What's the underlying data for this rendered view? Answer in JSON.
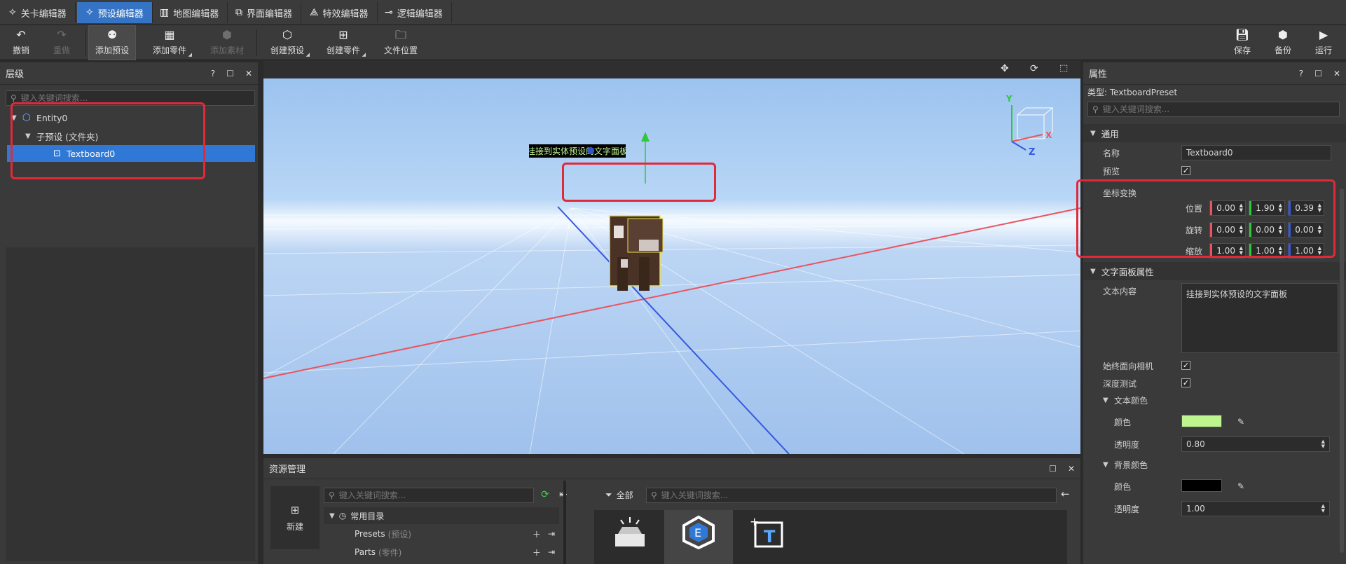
{
  "tabs": [
    {
      "label": "关卡编辑器",
      "icon": "level-icon",
      "active": false
    },
    {
      "label": "预设编辑器",
      "icon": "preset-icon",
      "active": true
    },
    {
      "label": "地图编辑器",
      "icon": "map-icon",
      "active": false
    },
    {
      "label": "界面编辑器",
      "icon": "ui-icon",
      "active": false
    },
    {
      "label": "特效编辑器",
      "icon": "effects-icon",
      "active": false
    },
    {
      "label": "逻辑编辑器",
      "icon": "logic-icon",
      "active": false
    }
  ],
  "toolbar": {
    "undo": "撤销",
    "redo": "重做",
    "add_preset": "添加预设",
    "add_part": "添加零件",
    "add_material": "添加素材",
    "create_preset": "创建预设",
    "create_part": "创建零件",
    "file_location": "文件位置",
    "save": "保存",
    "backup": "备份",
    "run": "运行"
  },
  "hierarchy": {
    "title": "层级",
    "help": "?",
    "search_placeholder": "键入关键词搜索...",
    "items": [
      {
        "label": "Entity0"
      },
      {
        "label": "子预设 (文件夹)"
      },
      {
        "label": "Textboard0"
      }
    ]
  },
  "viewport": {
    "textboard_text": "挂接到实体预设的文字面板",
    "gizmo": {
      "y": "Y",
      "x": "X",
      "z": "Z"
    }
  },
  "properties": {
    "title": "属性",
    "help": "?",
    "type": "类型: TextboardPreset",
    "search_placeholder": "键入关键词搜索...",
    "general": "通用",
    "name_label": "名称",
    "name_value": "Textboard0",
    "preview_label": "预览",
    "transform_label": "坐标变换",
    "position_label": "位置",
    "rotation_label": "旋转",
    "scale_label": "缩放",
    "position": [
      "0.00",
      "1.90",
      "0.39"
    ],
    "rotation": [
      "0.00",
      "0.00",
      "0.00"
    ],
    "scale": [
      "1.00",
      "1.00",
      "1.00"
    ],
    "textboard_section": "文字面板属性",
    "text_content_label": "文本内容",
    "text_content_value": "挂接到实体预设的文字面板",
    "face_camera_label": "始终面向相机",
    "depth_test_label": "深度测试",
    "text_color_section": "文本颜色",
    "color_label": "颜色",
    "text_color": "#bff58f",
    "opacity_label": "透明度",
    "text_opacity": "0.80",
    "bg_color_section": "背景颜色",
    "bg_color": "#000000",
    "bg_opacity": "1.00"
  },
  "assets": {
    "title": "资源管理",
    "new": "新建",
    "search_placeholder": "键入关键词搜索...",
    "common_dir": "常用目录",
    "presets": "Presets",
    "presets_tag": "(预设)",
    "parts": "Parts",
    "parts_tag": "(零件)",
    "filter_all": "全部",
    "right_search_placeholder": "键入关键词搜索..."
  },
  "colors": {
    "accent": "#3574c4",
    "highlight": "#e02a3a",
    "axis_red": "#e85560",
    "axis_green": "#2ec83a",
    "axis_blue": "#3558e0"
  }
}
